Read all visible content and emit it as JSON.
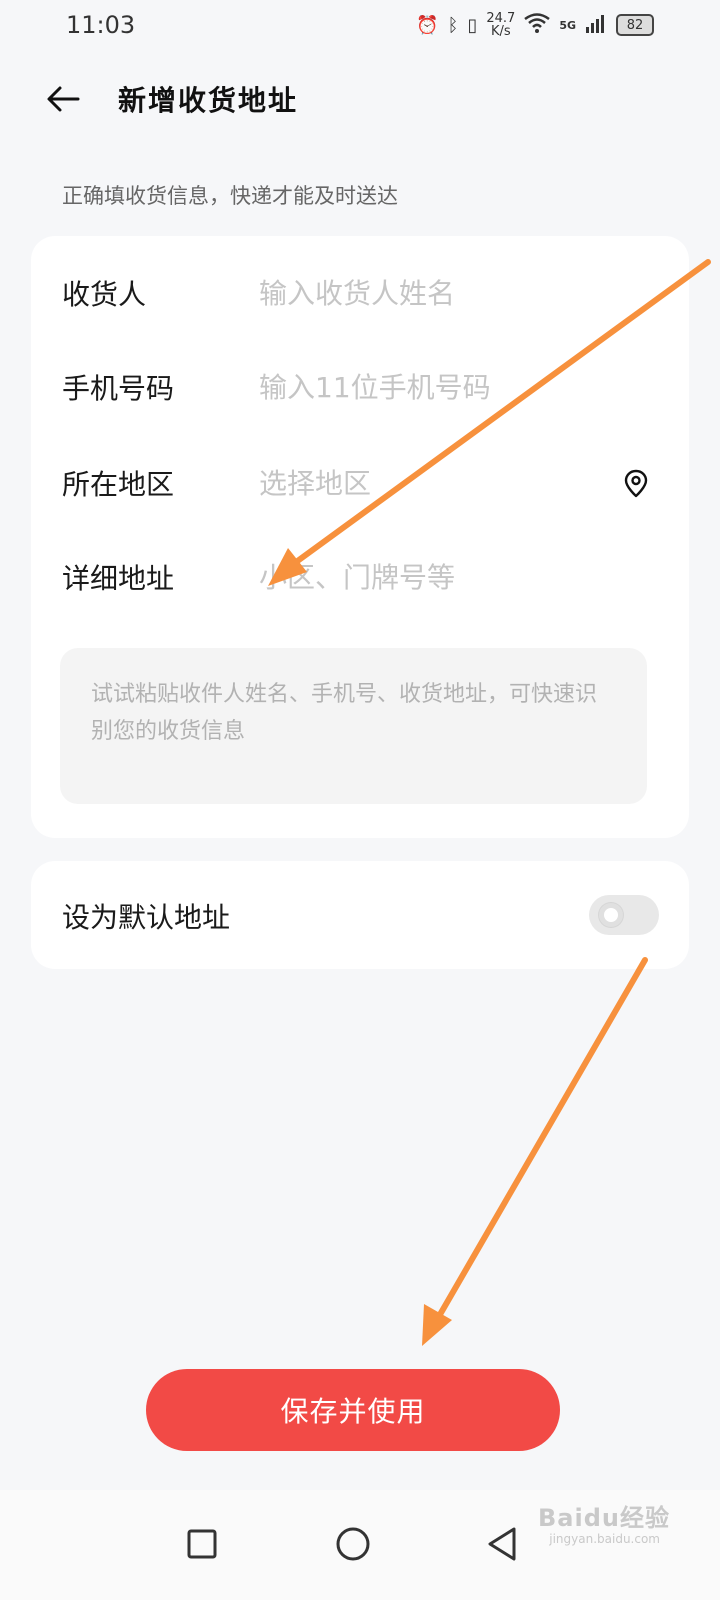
{
  "status_bar": {
    "time": "11:03",
    "speed_value": "24.7",
    "speed_unit": "K/s",
    "network": "5G",
    "battery": "82"
  },
  "header": {
    "title": "新增收货地址"
  },
  "tip": "正确填收货信息，快递才能及时送达",
  "form": {
    "recipient": {
      "label": "收货人",
      "placeholder": "输入收货人姓名"
    },
    "phone": {
      "label": "手机号码",
      "placeholder": "输入11位手机号码"
    },
    "region": {
      "label": "所在地区",
      "placeholder": "选择地区"
    },
    "detail": {
      "label": "详细地址",
      "placeholder": "小区、门牌号等"
    },
    "paste_placeholder": "试试粘贴收件人姓名、手机号、收货地址，可快速识别您的收货信息"
  },
  "default_address": {
    "label": "设为默认地址",
    "enabled": false
  },
  "save_button": "保存并使用",
  "watermark": {
    "brand": "Baidu经验",
    "url": "jingyan.baidu.com"
  },
  "colors": {
    "accent": "#f24a46",
    "annotation_arrow": "#f7913d",
    "background": "#f6f7f9"
  }
}
